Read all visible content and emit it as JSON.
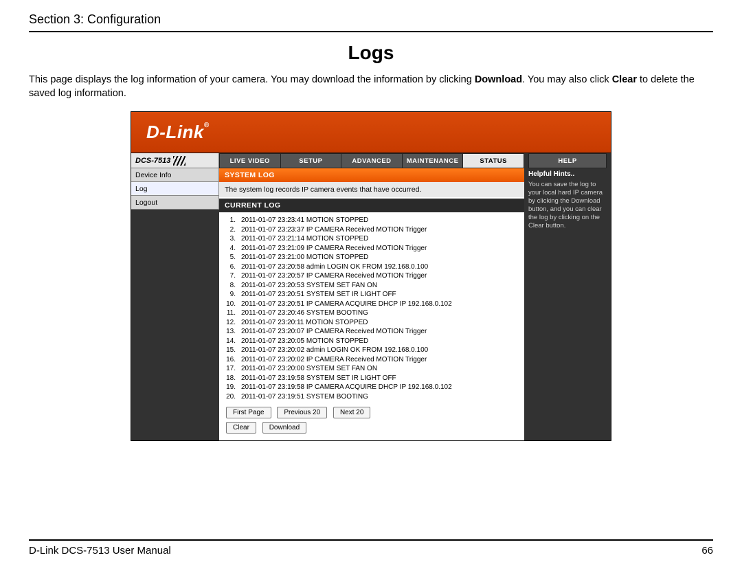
{
  "doc": {
    "section": "Section 3: Configuration",
    "title": "Logs",
    "intro_a": "This page displays the log information of your camera. You may download the information by clicking ",
    "intro_b1": "Download",
    "intro_c": ". You may also click ",
    "intro_b2": "Clear",
    "intro_d": " to delete the saved log information.",
    "footer_left": "D-Link DCS-7513 User Manual",
    "footer_right": "66"
  },
  "ui": {
    "brand": "D-Link",
    "model": "DCS-7513",
    "tabs": {
      "live": "LIVE VIDEO",
      "setup": "SETUP",
      "advanced": "ADVANCED",
      "maintenance": "MAINTENANCE",
      "status": "STATUS",
      "help": "HELP"
    },
    "sidebar": {
      "device_info": "Device Info",
      "log": "Log",
      "logout": "Logout"
    },
    "panel": {
      "sys_title": "SYSTEM LOG",
      "sys_desc": "The system log records IP camera events that have occurred.",
      "cur_title": "CURRENT LOG"
    },
    "logs": [
      "2011-01-07 23:23:41 MOTION STOPPED",
      "2011-01-07 23:23:37 IP CAMERA Received MOTION Trigger",
      "2011-01-07 23:21:14 MOTION STOPPED",
      "2011-01-07 23:21:09 IP CAMERA Received MOTION Trigger",
      "2011-01-07 23:21:00 MOTION STOPPED",
      "2011-01-07 23:20:58 admin LOGIN OK FROM 192.168.0.100",
      "2011-01-07 23:20:57 IP CAMERA Received MOTION Trigger",
      "2011-01-07 23:20:53 SYSTEM SET FAN ON",
      "2011-01-07 23:20:51 SYSTEM SET IR LIGHT OFF",
      "2011-01-07 23:20:51 IP CAMERA ACQUIRE DHCP IP 192.168.0.102",
      "2011-01-07 23:20:46 SYSTEM BOOTING",
      "2011-01-07 23:20:11 MOTION STOPPED",
      "2011-01-07 23:20:07 IP CAMERA Received MOTION Trigger",
      "2011-01-07 23:20:05 MOTION STOPPED",
      "2011-01-07 23:20:02 admin LOGIN OK FROM 192.168.0.100",
      "2011-01-07 23:20:02 IP CAMERA Received MOTION Trigger",
      "2011-01-07 23:20:00 SYSTEM SET FAN ON",
      "2011-01-07 23:19:58 SYSTEM SET IR LIGHT OFF",
      "2011-01-07 23:19:58 IP CAMERA ACQUIRE DHCP IP 192.168.0.102",
      "2011-01-07 23:19:51 SYSTEM BOOTING"
    ],
    "buttons": {
      "first": "First Page",
      "prev": "Previous 20",
      "next": "Next 20",
      "clear": "Clear",
      "download": "Download"
    },
    "hints": {
      "title": "Helpful Hints..",
      "text": "You can save the log to your local hard IP camera by clicking the Download button, and you can clear the log by clicking on the Clear button."
    }
  }
}
